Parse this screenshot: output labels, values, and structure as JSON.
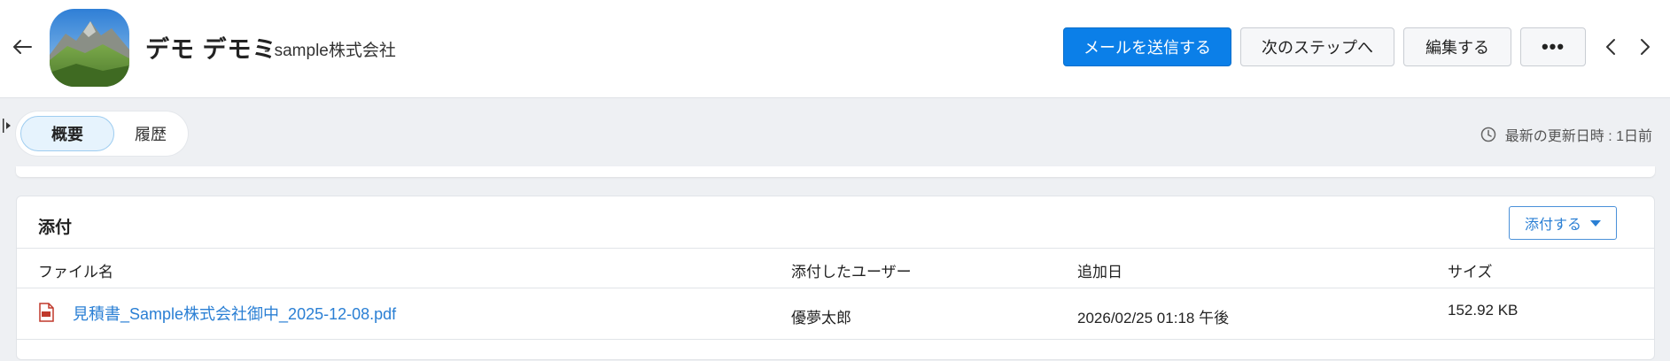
{
  "header": {
    "name": "デモ デモミ",
    "company": "- sample株式会社",
    "send_mail_label": "メールを送信する",
    "next_step_label": "次のステップへ",
    "edit_label": "編集する",
    "more_label": "•••"
  },
  "tabs": [
    {
      "label": "概要",
      "active": true
    },
    {
      "label": "履歴",
      "active": false
    }
  ],
  "last_updated": "最新の更新日時 : 1日前",
  "attachments": {
    "title": "添付",
    "attach_button_label": "添付する",
    "columns": [
      "ファイル名",
      "添付したユーザー",
      "追加日",
      "サイズ"
    ],
    "rows": [
      {
        "file_name": "見積書_Sample株式会社御中_2025-12-08.pdf",
        "user": "優夢太郎",
        "added": "2026/02/25 01:18 午後",
        "size": "152.92 KB"
      }
    ]
  },
  "colors": {
    "primary": "#0b7fe8",
    "link": "#2a7fd4",
    "active_tab_bg": "#e6f3fd",
    "page_bg": "#eef0f3"
  },
  "icons": {
    "back": "arrow-left-icon",
    "prev": "chevron-left-icon",
    "next": "chevron-right-icon",
    "clock": "clock-icon",
    "pdf": "pdf-file-icon",
    "sidebar": "sidebar-toggle-icon"
  }
}
